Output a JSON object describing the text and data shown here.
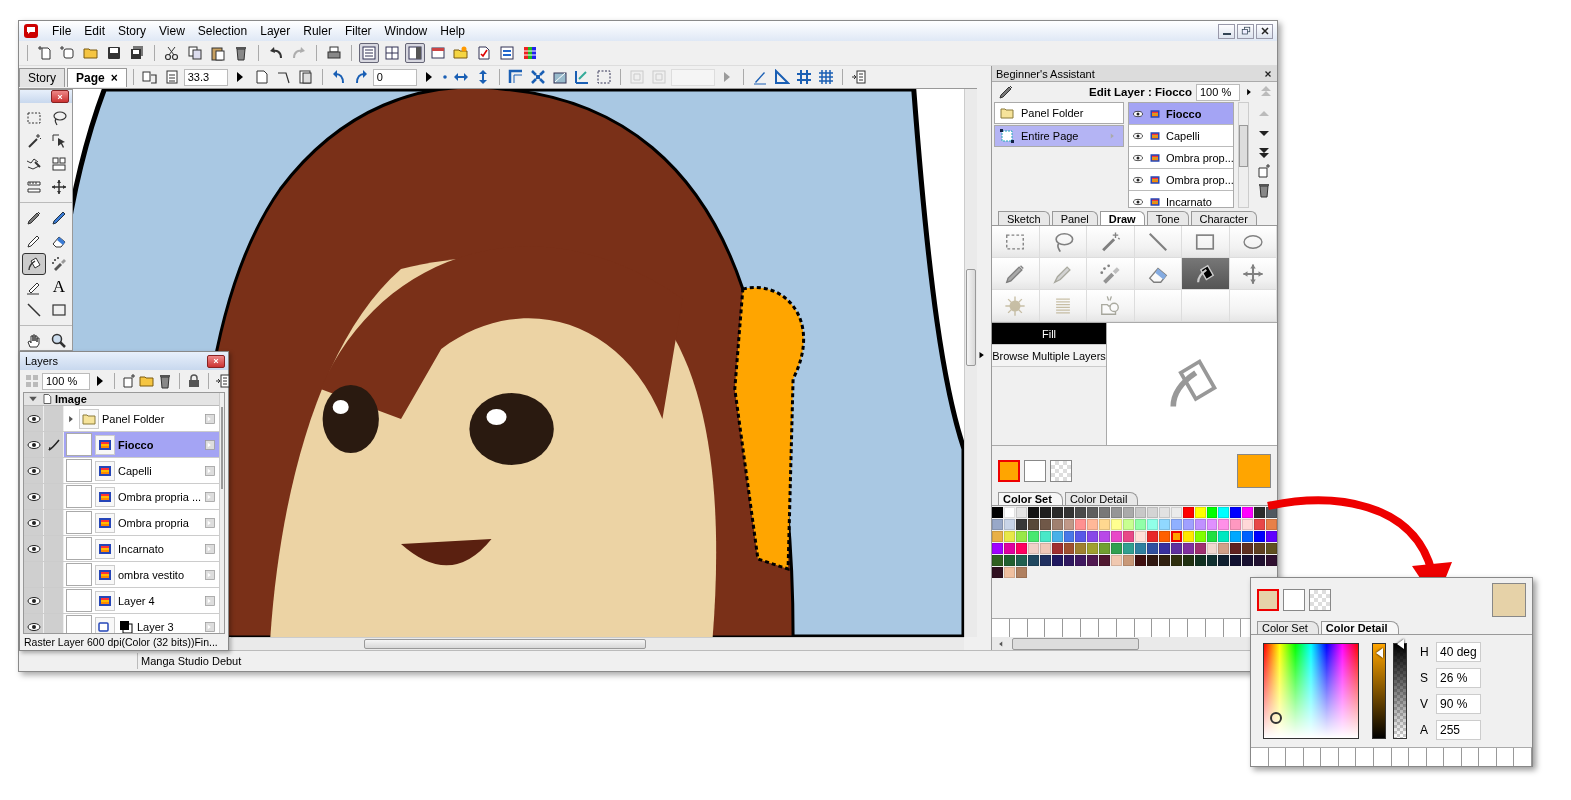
{
  "window": {
    "menus": [
      "File",
      "Edit",
      "Story",
      "View",
      "Selection",
      "Layer",
      "Ruler",
      "Filter",
      "Window",
      "Help"
    ]
  },
  "toolbar_groups": [
    {
      "buttons": [
        {
          "kind": "new-page",
          "pressed": false,
          "disabled": false
        },
        {
          "kind": "new-story",
          "pressed": false,
          "disabled": false
        },
        {
          "kind": "open",
          "pressed": false,
          "disabled": false
        },
        {
          "kind": "save",
          "pressed": false,
          "disabled": false
        },
        {
          "kind": "save-all",
          "pressed": false,
          "disabled": false
        }
      ]
    },
    {
      "buttons": [
        {
          "kind": "cut",
          "pressed": false,
          "disabled": false
        },
        {
          "kind": "copy",
          "pressed": false,
          "disabled": false
        },
        {
          "kind": "paste",
          "pressed": false,
          "disabled": false
        },
        {
          "kind": "trash",
          "pressed": false,
          "disabled": false
        }
      ]
    },
    {
      "buttons": [
        {
          "kind": "undo",
          "pressed": false,
          "disabled": false
        },
        {
          "kind": "redo",
          "pressed": false,
          "disabled": true
        }
      ]
    },
    {
      "buttons": [
        {
          "kind": "print",
          "pressed": false,
          "disabled": false
        }
      ]
    },
    {
      "buttons": [
        {
          "kind": "view-list",
          "pressed": true,
          "disabled": false
        },
        {
          "kind": "view-grid",
          "pressed": false,
          "disabled": false
        },
        {
          "kind": "view-side",
          "pressed": true,
          "disabled": false
        },
        {
          "kind": "window",
          "pressed": false,
          "disabled": false
        },
        {
          "kind": "folder-key",
          "pressed": false,
          "disabled": false
        },
        {
          "kind": "check",
          "pressed": false,
          "disabled": false
        },
        {
          "kind": "swap",
          "pressed": false,
          "disabled": false
        },
        {
          "kind": "color-grid",
          "pressed": false,
          "disabled": false
        }
      ]
    }
  ],
  "document_tabs": [
    {
      "label": "Story",
      "selected": false
    },
    {
      "label": "Page",
      "selected": true,
      "close": "×"
    }
  ],
  "canvas_toolbar": [
    {
      "items": [
        {
          "kind": "page-link",
          "disabled": false
        },
        {
          "kind": "page-list",
          "disabled": false
        },
        {
          "kind": "field",
          "value": "33.3",
          "disabled": false
        },
        {
          "kind": "play",
          "disabled": false
        },
        {
          "kind": "page-add",
          "disabled": false
        },
        {
          "kind": "page-turn",
          "disabled": false
        },
        {
          "kind": "page-stack",
          "disabled": false
        }
      ]
    },
    {
      "items": [
        {
          "kind": "rotate-left",
          "disabled": false
        },
        {
          "kind": "rotate-right",
          "disabled": false
        },
        {
          "kind": "field",
          "value": "0",
          "disabled": false
        },
        {
          "kind": "play",
          "disabled": false
        },
        {
          "kind": "dot",
          "disabled": false
        },
        {
          "kind": "flip-h",
          "disabled": false
        },
        {
          "kind": "flip-v",
          "disabled": false
        }
      ]
    },
    {
      "items": [
        {
          "kind": "corner",
          "disabled": false
        },
        {
          "kind": "fit",
          "disabled": false
        },
        {
          "kind": "view-tilt",
          "disabled": false
        },
        {
          "kind": "ruler-check",
          "disabled": false
        },
        {
          "kind": "dashed-box",
          "disabled": false
        }
      ]
    },
    {
      "items": [
        {
          "kind": "box-plain",
          "disabled": true
        },
        {
          "kind": "box-plain",
          "disabled": true
        },
        {
          "kind": "field",
          "disabled": true
        },
        {
          "kind": "play",
          "disabled": true
        }
      ]
    },
    {
      "items": [
        {
          "kind": "pen-ruler",
          "disabled": false
        },
        {
          "kind": "triangle-ruler",
          "disabled": false
        },
        {
          "kind": "hash",
          "disabled": false
        },
        {
          "kind": "hash-fine",
          "disabled": false
        }
      ]
    },
    {
      "items": [
        {
          "kind": "panel-toggle",
          "disabled": false
        }
      ]
    }
  ],
  "toolbox": {
    "groups": [
      {
        "tools": [
          {
            "kind": "marquee",
            "selected": false
          },
          {
            "kind": "lasso",
            "selected": false
          },
          {
            "kind": "wand",
            "selected": false
          },
          {
            "kind": "object-select",
            "selected": false
          },
          {
            "kind": "lines-select",
            "selected": false
          },
          {
            "kind": "panel-split",
            "selected": false
          },
          {
            "kind": "ruler-cut",
            "selected": false
          },
          {
            "kind": "move",
            "selected": false
          }
        ]
      },
      {
        "tools": [
          {
            "kind": "pen",
            "selected": false
          },
          {
            "kind": "pencil",
            "selected": false
          },
          {
            "kind": "pencil-small",
            "selected": false
          },
          {
            "kind": "eraser",
            "selected": false
          },
          {
            "kind": "fill",
            "selected": true
          },
          {
            "kind": "airbrush",
            "selected": false
          },
          {
            "kind": "line-pen",
            "selected": false
          },
          {
            "kind": "text",
            "glyph": "A",
            "selected": false
          },
          {
            "kind": "line",
            "selected": false
          },
          {
            "kind": "rect",
            "selected": false
          }
        ]
      },
      {
        "tools": [
          {
            "kind": "hand",
            "selected": false
          },
          {
            "kind": "zoom",
            "selected": false
          }
        ]
      }
    ]
  },
  "layers_panel": {
    "title": "Layers",
    "opacity": "100 %",
    "group": "Image",
    "layers": [
      {
        "name": "Panel Folder",
        "kind": "folder",
        "visible": true,
        "editing": false,
        "selected": false
      },
      {
        "name": "Fiocco",
        "kind": "raster",
        "visible": true,
        "editing": true,
        "selected": true
      },
      {
        "name": "Capelli",
        "kind": "raster",
        "visible": true,
        "editing": false,
        "selected": false
      },
      {
        "name": "Ombra propria ...",
        "kind": "raster",
        "visible": true,
        "editing": false,
        "selected": false
      },
      {
        "name": "Ombra propria",
        "kind": "raster",
        "visible": true,
        "editing": false,
        "selected": false
      },
      {
        "name": "Incarnato",
        "kind": "raster",
        "visible": true,
        "editing": false,
        "selected": false
      },
      {
        "name": "ombra vestito",
        "kind": "raster",
        "visible": false,
        "editing": false,
        "selected": false
      },
      {
        "name": "Layer 4",
        "kind": "raster",
        "visible": true,
        "editing": false,
        "selected": false
      },
      {
        "name": "Layer 3",
        "kind": "vector",
        "visible": true,
        "editing": false,
        "selected": false
      }
    ],
    "status": "Raster Layer 600 dpi(Color (32 bits))Fin..."
  },
  "assistant": {
    "title": "Beginner's Assistant",
    "edit_layer": "Edit Layer : Fiocco",
    "opacity": "100 %",
    "targets": [
      {
        "name": "Panel Folder",
        "kind": "folder",
        "selected": false
      },
      {
        "name": "Entire Page",
        "kind": "page",
        "selected": true
      }
    ],
    "layers": [
      {
        "name": "Fiocco",
        "selected": true
      },
      {
        "name": "Capelli",
        "selected": false
      },
      {
        "name": "Ombra prop...",
        "selected": false
      },
      {
        "name": "Ombra prop...",
        "selected": false
      },
      {
        "name": "Incarnato",
        "selected": false
      }
    ],
    "tabs": [
      {
        "label": "Sketch",
        "selected": false
      },
      {
        "label": "Panel",
        "selected": false
      },
      {
        "label": "Draw",
        "selected": true
      },
      {
        "label": "Tone",
        "selected": false
      },
      {
        "label": "Character",
        "selected": false
      }
    ],
    "tools": [
      {
        "kind": "marquee",
        "selected": false
      },
      {
        "kind": "lasso",
        "selected": false
      },
      {
        "kind": "wand",
        "selected": false
      },
      {
        "kind": "line",
        "selected": false
      },
      {
        "kind": "rect",
        "selected": false
      },
      {
        "kind": "ellipse",
        "selected": false
      },
      {
        "kind": "pen",
        "selected": false
      },
      {
        "kind": "marker",
        "selected": false
      },
      {
        "kind": "airbrush",
        "selected": false
      },
      {
        "kind": "eraser",
        "selected": false
      },
      {
        "kind": "fill",
        "selected": true
      },
      {
        "kind": "move",
        "selected": false
      },
      {
        "kind": "burst",
        "selected": false
      },
      {
        "kind": "hatch",
        "selected": false
      },
      {
        "kind": "import",
        "selected": false
      },
      {
        "kind": "empty",
        "selected": false
      },
      {
        "kind": "empty",
        "selected": false
      },
      {
        "kind": "empty",
        "selected": false
      }
    ],
    "sub_tools": [
      {
        "label": "Fill",
        "selected": true
      },
      {
        "label": "Browse Multiple Layers",
        "selected": false
      }
    ]
  },
  "color_panel": {
    "swatches": [
      {
        "kind": "main",
        "color": "#ffa500",
        "selected": true
      },
      {
        "kind": "sub",
        "color": "#ffffff",
        "selected": false
      },
      {
        "kind": "transparent",
        "selected": false
      }
    ],
    "tabs": [
      {
        "label": "Color Set",
        "selected": true
      },
      {
        "label": "Color Detail",
        "selected": false
      }
    ],
    "palette": [
      [
        {
          "color": "#000000",
          "selected": false
        },
        {
          "color": "#ffffff",
          "selected": false
        },
        {
          "color": "#e4e4e4",
          "selected": false
        },
        {
          "color": "#141414",
          "selected": false
        },
        {
          "color": "#1e1e1e",
          "selected": false
        },
        {
          "color": "#2a2a2a",
          "selected": false
        },
        {
          "color": "#333333",
          "selected": false
        },
        {
          "color": "#4a4a4a",
          "selected": false
        },
        {
          "color": "#5e5e5e",
          "selected": false
        },
        {
          "color": "#787878",
          "selected": false
        },
        {
          "color": "#969696",
          "selected": false
        },
        {
          "color": "#aaaaaa",
          "selected": false
        },
        {
          "color": "#c8c8c8",
          "selected": false
        },
        {
          "color": "#d4d4d4",
          "selected": false
        },
        {
          "color": "#e2e2e2",
          "selected": false
        },
        {
          "color": "#ebebeb",
          "selected": false
        },
        {
          "color": "#ff0000",
          "selected": false
        },
        {
          "color": "#ffff00",
          "selected": false
        },
        {
          "color": "#00ff00",
          "selected": false
        },
        {
          "color": "#00ffff",
          "selected": false
        },
        {
          "color": "#0000ff",
          "selected": false
        },
        {
          "color": "#ff00ff",
          "selected": false
        },
        {
          "color": "#2b2b2b",
          "selected": false
        },
        {
          "color": "#505860",
          "selected": false
        }
      ],
      [
        {
          "color": "#98a8c8",
          "selected": false
        },
        {
          "color": "#c8d4e8",
          "selected": false
        },
        {
          "color": "#383838",
          "selected": false
        },
        {
          "color": "#584838",
          "selected": false
        },
        {
          "color": "#705848",
          "selected": false
        },
        {
          "color": "#a08070",
          "selected": false
        },
        {
          "color": "#c09888",
          "selected": false
        },
        {
          "color": "#ff9090",
          "selected": false
        },
        {
          "color": "#ffb898",
          "selected": false
        },
        {
          "color": "#ffd890",
          "selected": false
        },
        {
          "color": "#ffff90",
          "selected": false
        },
        {
          "color": "#c8ff90",
          "selected": false
        },
        {
          "color": "#90ffa8",
          "selected": false
        },
        {
          "color": "#90ffe8",
          "selected": false
        },
        {
          "color": "#90d8ff",
          "selected": false
        },
        {
          "color": "#90b0ff",
          "selected": false
        },
        {
          "color": "#a0a0ff",
          "selected": false
        },
        {
          "color": "#c090ff",
          "selected": false
        },
        {
          "color": "#e090ff",
          "selected": false
        },
        {
          "color": "#ff90e8",
          "selected": false
        },
        {
          "color": "#ff98c0",
          "selected": false
        },
        {
          "color": "#ffd8d8",
          "selected": false
        },
        {
          "color": "#e84848",
          "selected": false
        },
        {
          "color": "#e88048",
          "selected": false
        }
      ],
      [
        {
          "color": "#e8b048",
          "selected": false
        },
        {
          "color": "#e8e848",
          "selected": false
        },
        {
          "color": "#98e848",
          "selected": false
        },
        {
          "color": "#48e870",
          "selected": false
        },
        {
          "color": "#48e8c8",
          "selected": false
        },
        {
          "color": "#48b0e8",
          "selected": false
        },
        {
          "color": "#4878e8",
          "selected": false
        },
        {
          "color": "#5858e8",
          "selected": false
        },
        {
          "color": "#8848e8",
          "selected": false
        },
        {
          "color": "#b848e8",
          "selected": false
        },
        {
          "color": "#e848c8",
          "selected": false
        },
        {
          "color": "#e84888",
          "selected": false
        },
        {
          "color": "#ffe0d8",
          "selected": false
        },
        {
          "color": "#e82828",
          "selected": false
        },
        {
          "color": "#ff6000",
          "selected": false
        },
        {
          "color": "#ffa000",
          "selected": true
        },
        {
          "color": "#ffe800",
          "selected": false
        },
        {
          "color": "#80ff00",
          "selected": false
        },
        {
          "color": "#20e040",
          "selected": false
        },
        {
          "color": "#00e8c0",
          "selected": false
        },
        {
          "color": "#00a8ff",
          "selected": false
        },
        {
          "color": "#0060ff",
          "selected": false
        },
        {
          "color": "#0000ff",
          "selected": false
        },
        {
          "color": "#6000ff",
          "selected": false
        }
      ],
      [
        {
          "color": "#a000ff",
          "selected": false
        },
        {
          "color": "#e000a0",
          "selected": false
        },
        {
          "color": "#ff0060",
          "selected": false
        },
        {
          "color": "#f0d0c8",
          "selected": false
        },
        {
          "color": "#f0c8b8",
          "selected": false
        },
        {
          "color": "#a03030",
          "selected": false
        },
        {
          "color": "#a05030",
          "selected": false
        },
        {
          "color": "#a08030",
          "selected": false
        },
        {
          "color": "#a0a030",
          "selected": false
        },
        {
          "color": "#70a030",
          "selected": false
        },
        {
          "color": "#30a050",
          "selected": false
        },
        {
          "color": "#30a090",
          "selected": false
        },
        {
          "color": "#3080a0",
          "selected": false
        },
        {
          "color": "#3050a0",
          "selected": false
        },
        {
          "color": "#3830a0",
          "selected": false
        },
        {
          "color": "#6030a0",
          "selected": false
        },
        {
          "color": "#8030a0",
          "selected": false
        },
        {
          "color": "#a03070",
          "selected": false
        },
        {
          "color": "#f0d8d0",
          "selected": false
        },
        {
          "color": "#d0a088",
          "selected": false
        },
        {
          "color": "#602020",
          "selected": false
        },
        {
          "color": "#603020",
          "selected": false
        },
        {
          "color": "#604020",
          "selected": false
        },
        {
          "color": "#605020",
          "selected": false
        }
      ],
      [
        {
          "color": "#306020",
          "selected": false
        },
        {
          "color": "#206030",
          "selected": false
        },
        {
          "color": "#206050",
          "selected": false
        },
        {
          "color": "#204860",
          "selected": false
        },
        {
          "color": "#203060",
          "selected": false
        },
        {
          "color": "#201860",
          "selected": false
        },
        {
          "color": "#301860",
          "selected": false
        },
        {
          "color": "#401860",
          "selected": false
        },
        {
          "color": "#501850",
          "selected": false
        },
        {
          "color": "#501830",
          "selected": false
        },
        {
          "color": "#f0c8b0",
          "selected": false
        },
        {
          "color": "#c89878",
          "selected": false
        },
        {
          "color": "#401010",
          "selected": false
        },
        {
          "color": "#301810",
          "selected": false
        },
        {
          "color": "#302010",
          "selected": false
        },
        {
          "color": "#303010",
          "selected": false
        },
        {
          "color": "#203010",
          "selected": false
        },
        {
          "color": "#103020",
          "selected": false
        },
        {
          "color": "#103030",
          "selected": false
        },
        {
          "color": "#102030",
          "selected": false
        },
        {
          "color": "#101030",
          "selected": false
        },
        {
          "color": "#181030",
          "selected": false
        },
        {
          "color": "#201030",
          "selected": false
        },
        {
          "color": "#301030",
          "selected": false
        }
      ],
      [
        {
          "color": "#301020",
          "selected": false
        },
        {
          "color": "#f0c0a0",
          "selected": false
        },
        {
          "color": "#b08060",
          "selected": false
        }
      ]
    ]
  },
  "status_bar": {
    "text": "Manga Studio Debut"
  },
  "color_detail_popup": {
    "swatches": [
      {
        "kind": "main",
        "color": "#e6d2a8",
        "selected": true
      },
      {
        "kind": "sub",
        "color": "#ffffff",
        "selected": false
      },
      {
        "kind": "transparent",
        "selected": false
      }
    ],
    "tabs": [
      {
        "label": "Color Set",
        "selected": false
      },
      {
        "label": "Color Detail",
        "selected": true
      }
    ],
    "sliders": [
      {
        "kind": "value",
        "level": 0.9
      },
      {
        "kind": "alpha",
        "level": 1
      }
    ],
    "fields": [
      {
        "label": "H",
        "value": "40 deg"
      },
      {
        "label": "S",
        "value": "26 %"
      },
      {
        "label": "V",
        "value": "90 %"
      },
      {
        "label": "A",
        "value": "255"
      }
    ]
  }
}
